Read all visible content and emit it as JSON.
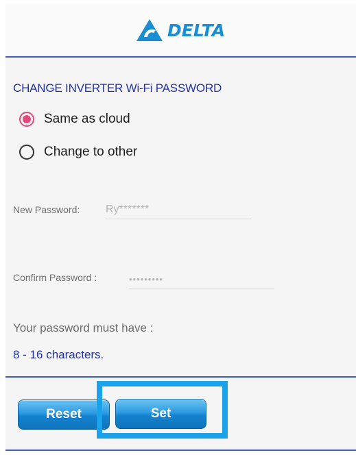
{
  "header": {
    "logo_text": "DELTA",
    "brand_color": "#1a8ed1"
  },
  "form": {
    "title": "CHANGE INVERTER Wi-Fi PASSWORD",
    "options": [
      {
        "label": "Same as cloud",
        "selected": true
      },
      {
        "label": "Change to other",
        "selected": false
      }
    ],
    "new_password": {
      "label": "New Password:",
      "value": "Ry*******"
    },
    "confirm_password": {
      "label": "Confirm Password :",
      "value": "•••••••••"
    },
    "requirement": {
      "label": "Your password must have :",
      "value": "8 - 16 characters."
    }
  },
  "buttons": {
    "reset_label": "Reset",
    "set_label": "Set"
  },
  "colors": {
    "accent_text": "#2233a8",
    "radio_selected": "#e5487a",
    "divider": "#3b5bbf",
    "button": "#1482cf",
    "highlight": "#1aa3ea"
  }
}
